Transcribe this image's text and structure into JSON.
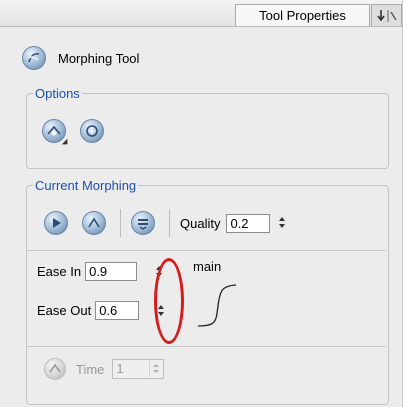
{
  "tabs": {
    "active_label": "Tool Properties",
    "other_icon": "dock-icon"
  },
  "tool": {
    "icon": "morphing-tool-icon",
    "name": "Morphing Tool"
  },
  "options": {
    "legend": "Options",
    "buttons": [
      {
        "icon": "morph-mode-icon",
        "has_dropdown": true
      },
      {
        "icon": "morph-settings-icon",
        "has_dropdown": false
      }
    ]
  },
  "current_morphing": {
    "legend": "Current Morphing",
    "buttons": [
      {
        "icon": "morph-play-icon"
      },
      {
        "icon": "morph-step-icon"
      },
      {
        "icon": "morph-list-icon"
      }
    ],
    "quality_label": "Quality",
    "quality_value": "0.2",
    "ease_in_label": "Ease In",
    "ease_in_value": "0.9",
    "ease_out_label": "Ease Out",
    "ease_out_value": "0.6",
    "curve_label": "main",
    "time_label": "Time",
    "time_value": "1"
  },
  "colors": {
    "legend": "#1a4fb4",
    "highlight": "#d81a1a",
    "panel": "#ececec"
  }
}
